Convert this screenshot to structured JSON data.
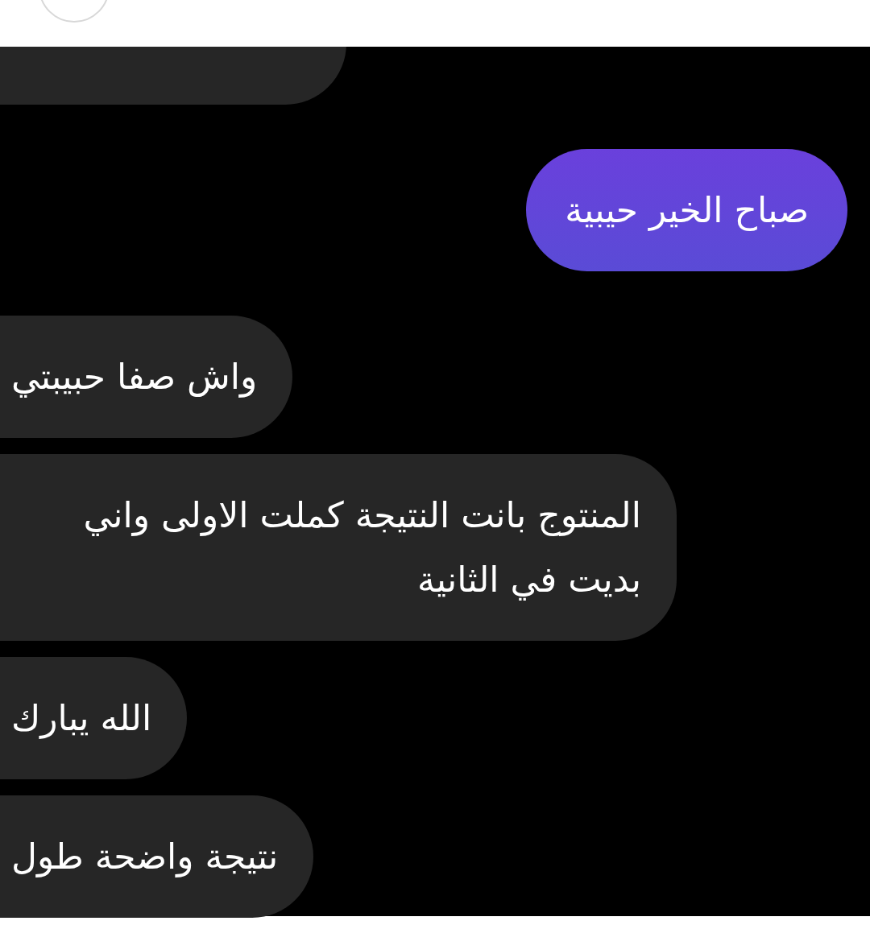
{
  "messages": [
    {
      "kind": "received"
    },
    {
      "kind": "sent",
      "text": "صباح الخير حيبية"
    },
    {
      "kind": "received",
      "text": "واش صفا حبيبتي"
    },
    {
      "kind": "received",
      "text": "المنتوج بانت النتيجة كملت الاولى واني بديت في الثانية"
    },
    {
      "kind": "received",
      "text": "الله يبارك"
    },
    {
      "kind": "received",
      "text": "نتيجة واضحة طول"
    }
  ]
}
